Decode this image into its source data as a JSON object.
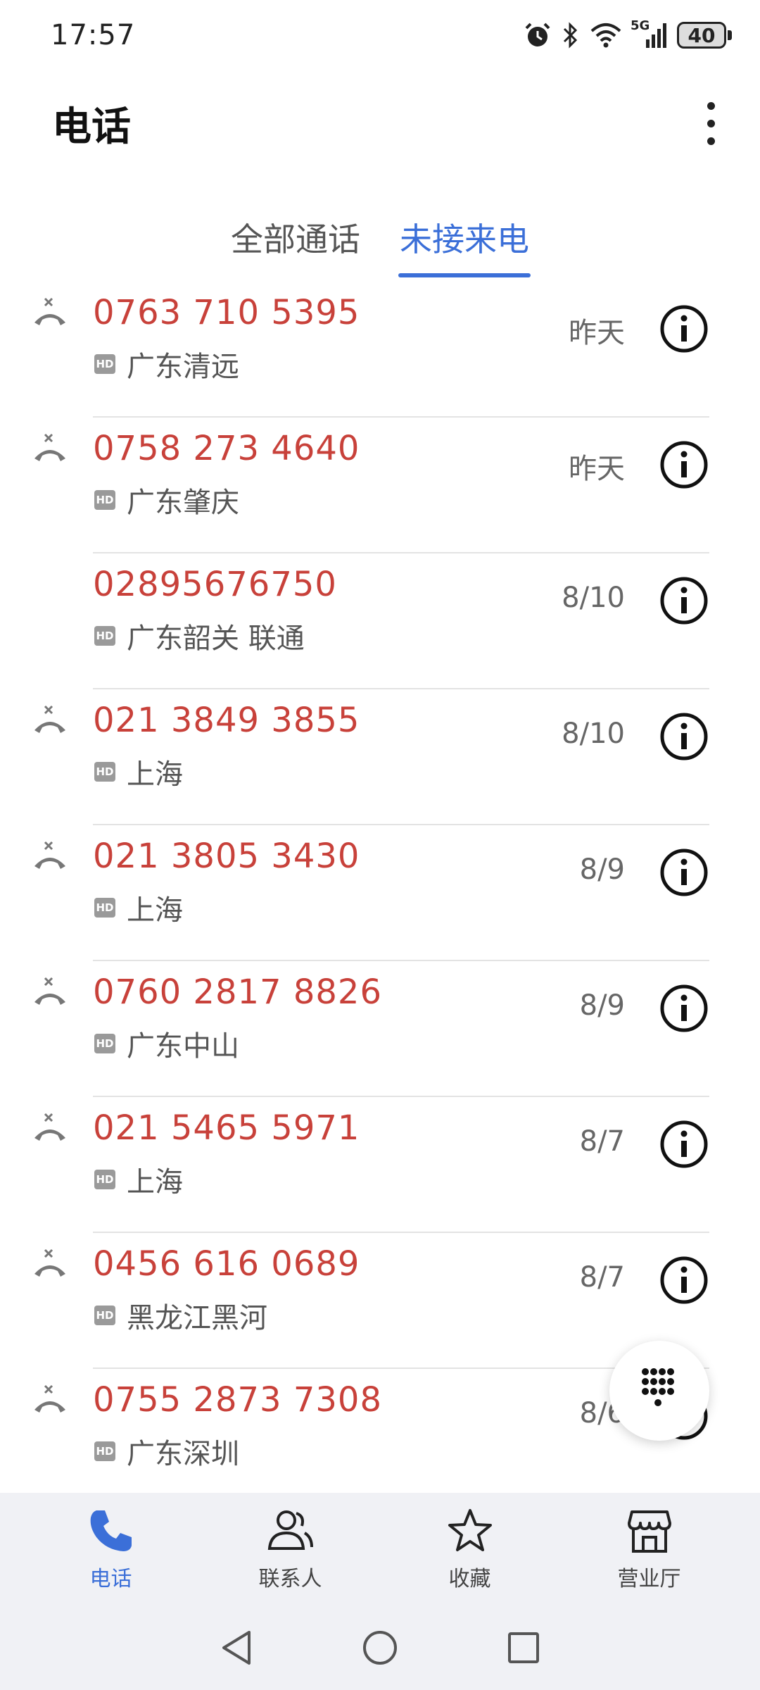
{
  "status_bar": {
    "time": "17:57",
    "network": "5G",
    "battery": "40",
    "icons": [
      "alarm-icon",
      "bluetooth-icon",
      "wifi-icon",
      "signal-icon",
      "battery-icon"
    ]
  },
  "header": {
    "title": "电话",
    "more_icon": "more-vertical-icon"
  },
  "tabs": [
    {
      "label": "全部通话",
      "active": false
    },
    {
      "label": "未接来电",
      "active": true
    }
  ],
  "calls": [
    {
      "number": "0763 710 5395",
      "location": "广东清远",
      "date": "昨天",
      "missed_icon": true
    },
    {
      "number": "0758 273 4640",
      "location": "广东肇庆",
      "date": "昨天",
      "missed_icon": true
    },
    {
      "number": "02895676750",
      "location": "广东韶关 联通",
      "date": "8/10",
      "missed_icon": false
    },
    {
      "number": "021 3849 3855",
      "location": "上海",
      "date": "8/10",
      "missed_icon": true
    },
    {
      "number": "021 3805 3430",
      "location": "上海",
      "date": "8/9",
      "missed_icon": true
    },
    {
      "number": "0760 2817 8826",
      "location": "广东中山",
      "date": "8/9",
      "missed_icon": true
    },
    {
      "number": "021 5465 5971",
      "location": "上海",
      "date": "8/7",
      "missed_icon": true
    },
    {
      "number": "0456 616 0689",
      "location": "黑龙江黑河",
      "date": "8/7",
      "missed_icon": true
    },
    {
      "number": "0755 2873 7308",
      "location": "广东深圳",
      "date": "8/6",
      "missed_icon": true
    }
  ],
  "hd_badge": "HD",
  "bottom_nav": [
    {
      "label": "电话",
      "icon": "phone-icon",
      "active": true
    },
    {
      "label": "联系人",
      "icon": "contacts-icon",
      "active": false
    },
    {
      "label": "收藏",
      "icon": "star-icon",
      "active": false
    },
    {
      "label": "营业厅",
      "icon": "store-icon",
      "active": false
    }
  ],
  "colors": {
    "accent": "#3b6fd8",
    "missed": "#c8413a",
    "nav_bg": "#f0f1f5"
  }
}
